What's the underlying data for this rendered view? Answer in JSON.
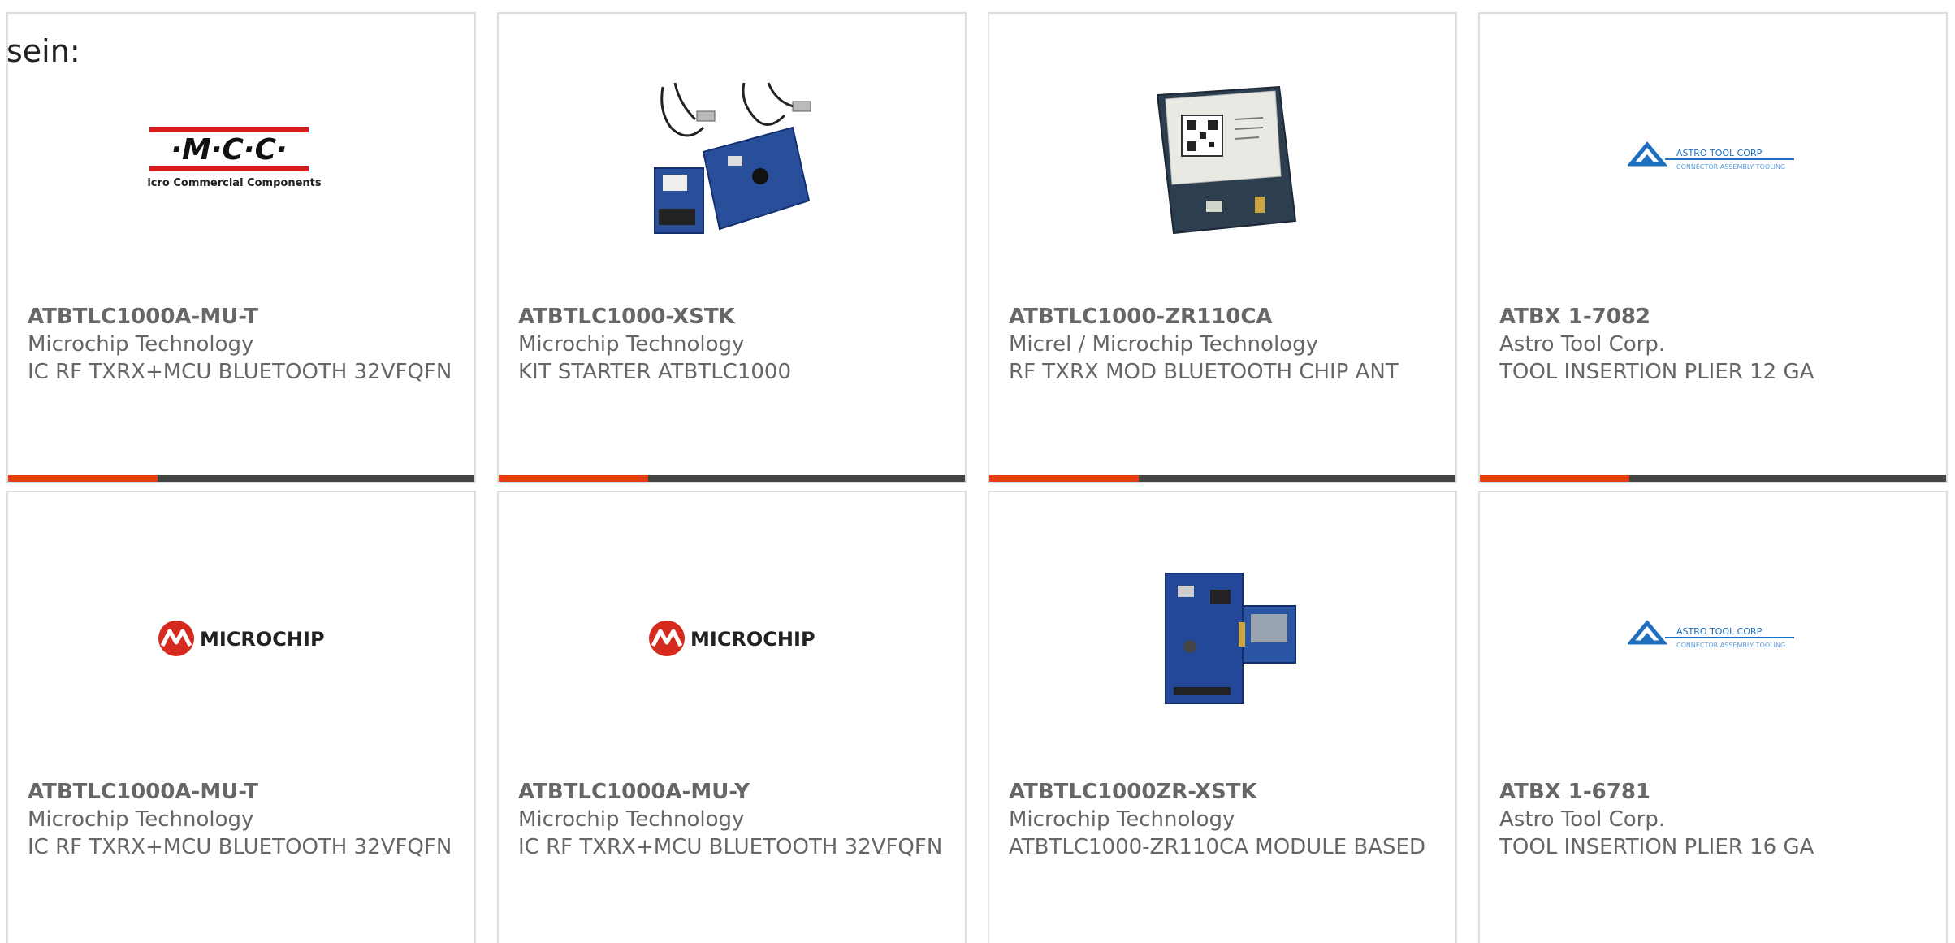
{
  "intro_text": "sein:",
  "accent_color": "#e8400c",
  "bar_color": "#444444",
  "cards": [
    {
      "part_number": "ATBTLC1000A-MU-T",
      "manufacturer": "Microchip Technology",
      "description": "IC RF TXRX+MCU BLUETOOTH 32VFQFN",
      "image": "mcc-logo",
      "logo_text": "·M·C·C·",
      "logo_subtext": "Micro Commercial Components"
    },
    {
      "part_number": "ATBTLC1000-XSTK",
      "manufacturer": "Microchip Technology",
      "description": "KIT STARTER ATBTLC1000",
      "image": "starter-kit-board-photo"
    },
    {
      "part_number": "ATBTLC1000-ZR110CA",
      "manufacturer": "Micrel / Microchip Technology",
      "description": "RF TXRX MOD BLUETOOTH CHIP ANT",
      "image": "bluetooth-module-photo"
    },
    {
      "part_number": "ATBX 1-7082",
      "manufacturer": "Astro Tool Corp.",
      "description": "TOOL INSERTION PLIER 12 GA",
      "image": "astro-tool-logo",
      "logo_text": "ASTRO TOOL CORP",
      "logo_subtext": "CONNECTOR ASSEMBLY TOOLING"
    },
    {
      "part_number": "ATBTLC1000A-MU-T",
      "manufacturer": "Microchip Technology",
      "description": "IC RF TXRX+MCU BLUETOOTH 32VFQFN",
      "image": "microchip-logo",
      "logo_text": "MICROCHIP"
    },
    {
      "part_number": "ATBTLC1000A-MU-Y",
      "manufacturer": "Microchip Technology",
      "description": "IC RF TXRX+MCU BLUETOOTH 32VFQFN",
      "image": "microchip-logo",
      "logo_text": "MICROCHIP"
    },
    {
      "part_number": "ATBTLC1000ZR-XSTK",
      "manufacturer": "Microchip Technology",
      "description": "ATBTLC1000-ZR110CA MODULE BASED",
      "image": "xstk-board-photo"
    },
    {
      "part_number": "ATBX 1-6781",
      "manufacturer": "Astro Tool Corp.",
      "description": "TOOL INSERTION PLIER 16 GA",
      "image": "astro-tool-logo",
      "logo_text": "ASTRO TOOL CORP",
      "logo_subtext": "CONNECTOR ASSEMBLY TOOLING"
    }
  ]
}
